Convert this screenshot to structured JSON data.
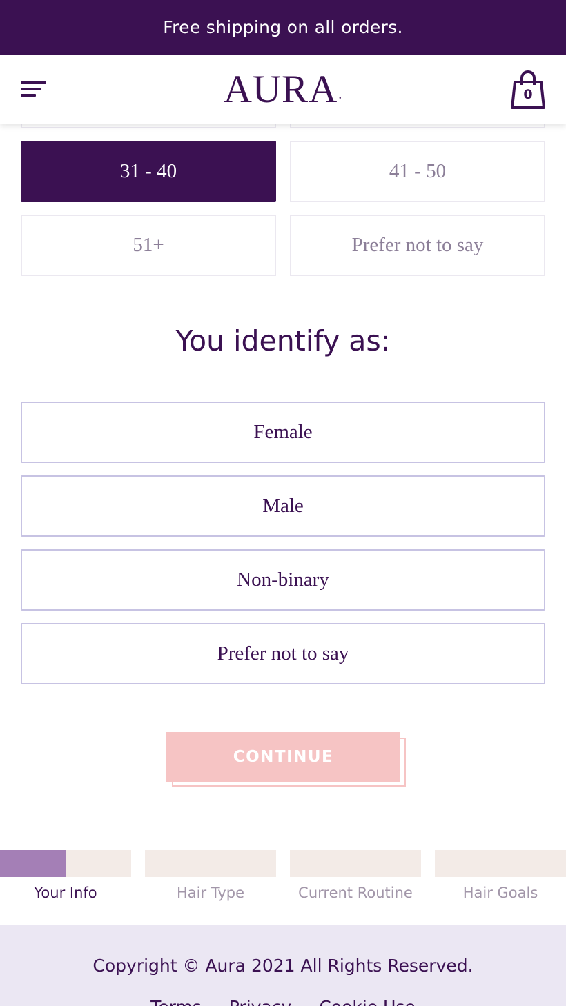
{
  "promo": {
    "text": "Free shipping on all orders."
  },
  "header": {
    "logo": "AURA",
    "logo_dot": ".",
    "cart_count": "0",
    "menu_icon": "hamburger-icon",
    "cart_icon": "shopping-bag-icon"
  },
  "age": {
    "options": [
      {
        "label": "31 - 40",
        "selected": true
      },
      {
        "label": "41 - 50",
        "selected": false
      },
      {
        "label": "51+",
        "selected": false
      },
      {
        "label": "Prefer not to say",
        "selected": false
      }
    ]
  },
  "identity": {
    "title": "You identify as:",
    "options": [
      "Female",
      "Male",
      "Non-binary",
      "Prefer not to say"
    ]
  },
  "continue_label": "CONTINUE",
  "progress": {
    "steps": [
      {
        "label": "Your Info",
        "active": true,
        "fill": 0.5
      },
      {
        "label": "Hair Type",
        "active": false,
        "fill": 0
      },
      {
        "label": "Current Routine",
        "active": false,
        "fill": 0
      },
      {
        "label": "Hair Goals",
        "active": false,
        "fill": 0
      }
    ]
  },
  "footer": {
    "copyright": "Copyright © Aura 2021 All Rights Reserved.",
    "links": [
      "Terms",
      "Privacy",
      "Cookie Use"
    ]
  },
  "colors": {
    "brand_purple": "#3b1152",
    "progress_fill": "#a47fb6",
    "continue_disabled": "#f6c4c4",
    "footer_bg": "#ebe7f3"
  }
}
